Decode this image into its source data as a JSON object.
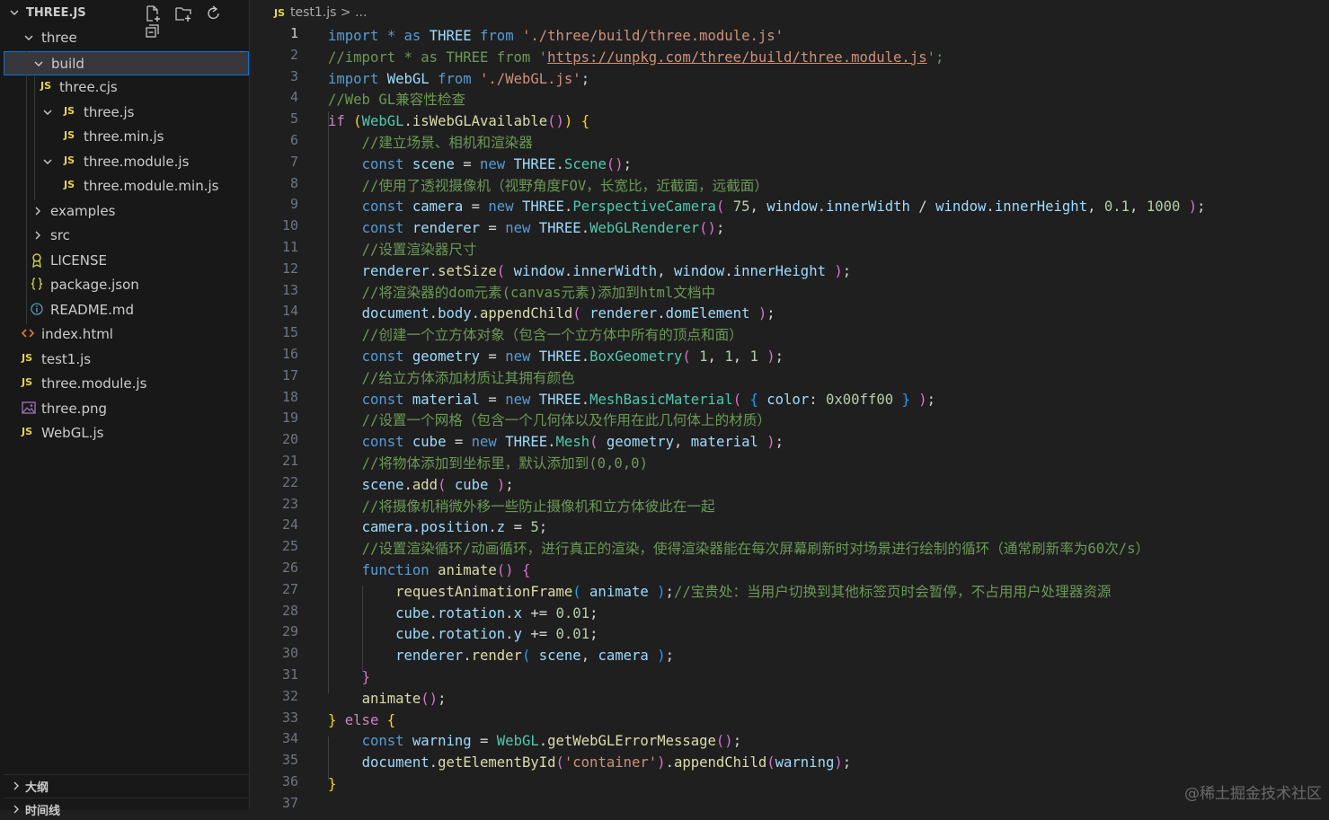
{
  "explorer": {
    "title": "THREE.JS",
    "actions": [
      "new-file-icon",
      "new-folder-icon",
      "refresh-icon",
      "collapse-all-icon"
    ],
    "items": [
      {
        "label": "three",
        "kind": "folder",
        "depth": 1,
        "expanded": true,
        "icon": "chevron-down-icon"
      },
      {
        "label": "build",
        "kind": "folder",
        "depth": 2,
        "expanded": true,
        "selected": true,
        "icon": "chevron-down-icon"
      },
      {
        "label": "three.cjs",
        "kind": "js",
        "depth": 3,
        "icon": "js-file-icon"
      },
      {
        "label": "three.js",
        "kind": "js",
        "depth": 3,
        "expanded": true,
        "icon": "js-file-icon"
      },
      {
        "label": "three.min.js",
        "kind": "js",
        "depth": 4,
        "icon": "js-file-icon"
      },
      {
        "label": "three.module.js",
        "kind": "js",
        "depth": 3,
        "expanded": true,
        "icon": "js-file-icon"
      },
      {
        "label": "three.module.min.js",
        "kind": "js",
        "depth": 4,
        "icon": "js-file-icon"
      },
      {
        "label": "examples",
        "kind": "folder",
        "depth": 2,
        "expanded": false,
        "icon": "chevron-right-icon"
      },
      {
        "label": "src",
        "kind": "folder",
        "depth": 2,
        "expanded": false,
        "icon": "chevron-right-icon"
      },
      {
        "label": "LICENSE",
        "kind": "license",
        "depth": 2,
        "icon": "license-icon"
      },
      {
        "label": "package.json",
        "kind": "json",
        "depth": 2,
        "icon": "json-file-icon"
      },
      {
        "label": "README.md",
        "kind": "info",
        "depth": 2,
        "icon": "info-icon"
      },
      {
        "label": "index.html",
        "kind": "html",
        "depth": 1,
        "icon": "html-file-icon"
      },
      {
        "label": "test1.js",
        "kind": "js",
        "depth": 1,
        "icon": "js-file-icon"
      },
      {
        "label": "three.module.js",
        "kind": "js",
        "depth": 1,
        "icon": "js-file-icon"
      },
      {
        "label": "three.png",
        "kind": "image",
        "depth": 1,
        "icon": "image-file-icon"
      },
      {
        "label": "WebGL.js",
        "kind": "js",
        "depth": 1,
        "icon": "js-file-icon"
      }
    ],
    "outline_label": "大纲",
    "timeline_label": "时间线"
  },
  "editor": {
    "file_icon_text": "JS",
    "breadcrumb_file": "test1.js",
    "breadcrumb_sep": ">",
    "breadcrumb_more": "...",
    "active_line": 1,
    "lines": [
      [
        [
          "kw",
          "import"
        ],
        [
          "pun",
          " "
        ],
        [
          "kw",
          "*"
        ],
        [
          "pun",
          " "
        ],
        [
          "kw",
          "as"
        ],
        [
          "pun",
          " "
        ],
        [
          "var",
          "THREE"
        ],
        [
          "pun",
          " "
        ],
        [
          "kw",
          "from"
        ],
        [
          "pun",
          " "
        ],
        [
          "str",
          "'./three/build/three.module.js'"
        ]
      ],
      [
        [
          "cmt",
          "//import * as THREE from '"
        ],
        [
          "link",
          "https://unpkg.com/three/build/three.module.js"
        ],
        [
          "cmt",
          "';"
        ]
      ],
      [
        [
          "kw",
          "import"
        ],
        [
          "pun",
          " "
        ],
        [
          "var",
          "WebGL"
        ],
        [
          "pun",
          " "
        ],
        [
          "kw",
          "from"
        ],
        [
          "pun",
          " "
        ],
        [
          "str",
          "'./WebGL.js'"
        ],
        [
          "pun",
          ";"
        ]
      ],
      [
        [
          "cmt",
          "//Web GL兼容性检查"
        ]
      ],
      [
        [
          "ctl",
          "if"
        ],
        [
          "pun",
          " "
        ],
        [
          "br1",
          "("
        ],
        [
          "cls",
          "WebGL"
        ],
        [
          "pun",
          "."
        ],
        [
          "fn",
          "isWebGLAvailable"
        ],
        [
          "br2",
          "()"
        ],
        [
          "br1",
          ")"
        ],
        [
          "pun",
          " "
        ],
        [
          "br1",
          "{"
        ]
      ],
      [
        [
          "pun",
          "    "
        ],
        [
          "cmt",
          "//建立场景、相机和渲染器"
        ]
      ],
      [
        [
          "pun",
          "    "
        ],
        [
          "kw",
          "const"
        ],
        [
          "pun",
          " "
        ],
        [
          "var",
          "scene"
        ],
        [
          "pun",
          " = "
        ],
        [
          "kw",
          "new"
        ],
        [
          "pun",
          " "
        ],
        [
          "var",
          "THREE"
        ],
        [
          "pun",
          "."
        ],
        [
          "cls",
          "Scene"
        ],
        [
          "br2",
          "()"
        ],
        [
          "pun",
          ";"
        ]
      ],
      [
        [
          "pun",
          "    "
        ],
        [
          "cmt",
          "//使用了透视摄像机（视野角度FOV，长宽比，近截面，远截面）"
        ]
      ],
      [
        [
          "pun",
          "    "
        ],
        [
          "kw",
          "const"
        ],
        [
          "pun",
          " "
        ],
        [
          "var",
          "camera"
        ],
        [
          "pun",
          " = "
        ],
        [
          "kw",
          "new"
        ],
        [
          "pun",
          " "
        ],
        [
          "var",
          "THREE"
        ],
        [
          "pun",
          "."
        ],
        [
          "cls",
          "PerspectiveCamera"
        ],
        [
          "br2",
          "("
        ],
        [
          "pun",
          " "
        ],
        [
          "num",
          "75"
        ],
        [
          "pun",
          ", "
        ],
        [
          "var",
          "window"
        ],
        [
          "pun",
          "."
        ],
        [
          "var",
          "innerWidth"
        ],
        [
          "pun",
          " / "
        ],
        [
          "var",
          "window"
        ],
        [
          "pun",
          "."
        ],
        [
          "var",
          "innerHeight"
        ],
        [
          "pun",
          ", "
        ],
        [
          "num",
          "0.1"
        ],
        [
          "pun",
          ", "
        ],
        [
          "num",
          "1000"
        ],
        [
          "pun",
          " "
        ],
        [
          "br2",
          ")"
        ],
        [
          "pun",
          ";"
        ]
      ],
      [
        [
          "pun",
          "    "
        ],
        [
          "kw",
          "const"
        ],
        [
          "pun",
          " "
        ],
        [
          "var",
          "renderer"
        ],
        [
          "pun",
          " = "
        ],
        [
          "kw",
          "new"
        ],
        [
          "pun",
          " "
        ],
        [
          "var",
          "THREE"
        ],
        [
          "pun",
          "."
        ],
        [
          "cls",
          "WebGLRenderer"
        ],
        [
          "br2",
          "()"
        ],
        [
          "pun",
          ";"
        ]
      ],
      [
        [
          "pun",
          "    "
        ],
        [
          "cmt",
          "//设置渲染器尺寸"
        ]
      ],
      [
        [
          "pun",
          "    "
        ],
        [
          "var",
          "renderer"
        ],
        [
          "pun",
          "."
        ],
        [
          "fn",
          "setSize"
        ],
        [
          "br2",
          "("
        ],
        [
          "pun",
          " "
        ],
        [
          "var",
          "window"
        ],
        [
          "pun",
          "."
        ],
        [
          "var",
          "innerWidth"
        ],
        [
          "pun",
          ", "
        ],
        [
          "var",
          "window"
        ],
        [
          "pun",
          "."
        ],
        [
          "var",
          "innerHeight"
        ],
        [
          "pun",
          " "
        ],
        [
          "br2",
          ")"
        ],
        [
          "pun",
          ";"
        ]
      ],
      [
        [
          "pun",
          "    "
        ],
        [
          "cmt",
          "//将渲染器的dom元素(canvas元素)添加到html文档中"
        ]
      ],
      [
        [
          "pun",
          "    "
        ],
        [
          "var",
          "document"
        ],
        [
          "pun",
          "."
        ],
        [
          "var",
          "body"
        ],
        [
          "pun",
          "."
        ],
        [
          "fn",
          "appendChild"
        ],
        [
          "br2",
          "("
        ],
        [
          "pun",
          " "
        ],
        [
          "var",
          "renderer"
        ],
        [
          "pun",
          "."
        ],
        [
          "var",
          "domElement"
        ],
        [
          "pun",
          " "
        ],
        [
          "br2",
          ")"
        ],
        [
          "pun",
          ";"
        ]
      ],
      [
        [
          "pun",
          "    "
        ],
        [
          "cmt",
          "//创建一个立方体对象（包含一个立方体中所有的顶点和面）"
        ]
      ],
      [
        [
          "pun",
          "    "
        ],
        [
          "kw",
          "const"
        ],
        [
          "pun",
          " "
        ],
        [
          "var",
          "geometry"
        ],
        [
          "pun",
          " = "
        ],
        [
          "kw",
          "new"
        ],
        [
          "pun",
          " "
        ],
        [
          "var",
          "THREE"
        ],
        [
          "pun",
          "."
        ],
        [
          "cls",
          "BoxGeometry"
        ],
        [
          "br2",
          "("
        ],
        [
          "pun",
          " "
        ],
        [
          "num",
          "1"
        ],
        [
          "pun",
          ", "
        ],
        [
          "num",
          "1"
        ],
        [
          "pun",
          ", "
        ],
        [
          "num",
          "1"
        ],
        [
          "pun",
          " "
        ],
        [
          "br2",
          ")"
        ],
        [
          "pun",
          ";"
        ]
      ],
      [
        [
          "pun",
          "    "
        ],
        [
          "cmt",
          "//给立方体添加材质让其拥有颜色"
        ]
      ],
      [
        [
          "pun",
          "    "
        ],
        [
          "kw",
          "const"
        ],
        [
          "pun",
          " "
        ],
        [
          "var",
          "material"
        ],
        [
          "pun",
          " = "
        ],
        [
          "kw",
          "new"
        ],
        [
          "pun",
          " "
        ],
        [
          "var",
          "THREE"
        ],
        [
          "pun",
          "."
        ],
        [
          "cls",
          "MeshBasicMaterial"
        ],
        [
          "br2",
          "("
        ],
        [
          "pun",
          " "
        ],
        [
          "br3",
          "{"
        ],
        [
          "pun",
          " "
        ],
        [
          "var",
          "color"
        ],
        [
          "pun",
          ": "
        ],
        [
          "num",
          "0x00ff00"
        ],
        [
          "pun",
          " "
        ],
        [
          "br3",
          "}"
        ],
        [
          "pun",
          " "
        ],
        [
          "br2",
          ")"
        ],
        [
          "pun",
          ";"
        ]
      ],
      [
        [
          "pun",
          "    "
        ],
        [
          "cmt",
          "//设置一个网格（包含一个几何体以及作用在此几何体上的材质）"
        ]
      ],
      [
        [
          "pun",
          "    "
        ],
        [
          "kw",
          "const"
        ],
        [
          "pun",
          " "
        ],
        [
          "var",
          "cube"
        ],
        [
          "pun",
          " = "
        ],
        [
          "kw",
          "new"
        ],
        [
          "pun",
          " "
        ],
        [
          "var",
          "THREE"
        ],
        [
          "pun",
          "."
        ],
        [
          "cls",
          "Mesh"
        ],
        [
          "br2",
          "("
        ],
        [
          "pun",
          " "
        ],
        [
          "var",
          "geometry"
        ],
        [
          "pun",
          ", "
        ],
        [
          "var",
          "material"
        ],
        [
          "pun",
          " "
        ],
        [
          "br2",
          ")"
        ],
        [
          "pun",
          ";"
        ]
      ],
      [
        [
          "pun",
          "    "
        ],
        [
          "cmt",
          "//将物体添加到坐标里，默认添加到(0,0,0)"
        ]
      ],
      [
        [
          "pun",
          "    "
        ],
        [
          "var",
          "scene"
        ],
        [
          "pun",
          "."
        ],
        [
          "fn",
          "add"
        ],
        [
          "br2",
          "("
        ],
        [
          "pun",
          " "
        ],
        [
          "var",
          "cube"
        ],
        [
          "pun",
          " "
        ],
        [
          "br2",
          ")"
        ],
        [
          "pun",
          ";"
        ]
      ],
      [
        [
          "pun",
          "    "
        ],
        [
          "cmt",
          "//将摄像机稍微外移一些防止摄像机和立方体彼此在一起"
        ]
      ],
      [
        [
          "pun",
          "    "
        ],
        [
          "var",
          "camera"
        ],
        [
          "pun",
          "."
        ],
        [
          "var",
          "position"
        ],
        [
          "pun",
          "."
        ],
        [
          "var",
          "z"
        ],
        [
          "pun",
          " = "
        ],
        [
          "num",
          "5"
        ],
        [
          "pun",
          ";"
        ]
      ],
      [
        [
          "pun",
          "    "
        ],
        [
          "cmt",
          "//设置渲染循环/动画循环，进行真正的渲染，使得渲染器能在每次屏幕刷新时对场景进行绘制的循环（通常刷新率为60次/s）"
        ]
      ],
      [
        [
          "pun",
          "    "
        ],
        [
          "kw",
          "function"
        ],
        [
          "pun",
          " "
        ],
        [
          "fn",
          "animate"
        ],
        [
          "br2",
          "()"
        ],
        [
          "pun",
          " "
        ],
        [
          "br2",
          "{"
        ]
      ],
      [
        [
          "pun",
          "        "
        ],
        [
          "fn",
          "requestAnimationFrame"
        ],
        [
          "br3",
          "("
        ],
        [
          "pun",
          " "
        ],
        [
          "var",
          "animate"
        ],
        [
          "pun",
          " "
        ],
        [
          "br3",
          ")"
        ],
        [
          "pun",
          ";"
        ],
        [
          "cmt",
          "//宝贵处：当用户切换到其他标签页时会暂停，不占用用户处理器资源"
        ]
      ],
      [
        [
          "pun",
          "        "
        ],
        [
          "var",
          "cube"
        ],
        [
          "pun",
          "."
        ],
        [
          "var",
          "rotation"
        ],
        [
          "pun",
          "."
        ],
        [
          "var",
          "x"
        ],
        [
          "pun",
          " += "
        ],
        [
          "num",
          "0.01"
        ],
        [
          "pun",
          ";"
        ]
      ],
      [
        [
          "pun",
          "        "
        ],
        [
          "var",
          "cube"
        ],
        [
          "pun",
          "."
        ],
        [
          "var",
          "rotation"
        ],
        [
          "pun",
          "."
        ],
        [
          "var",
          "y"
        ],
        [
          "pun",
          " += "
        ],
        [
          "num",
          "0.01"
        ],
        [
          "pun",
          ";"
        ]
      ],
      [
        [
          "pun",
          "        "
        ],
        [
          "var",
          "renderer"
        ],
        [
          "pun",
          "."
        ],
        [
          "fn",
          "render"
        ],
        [
          "br3",
          "("
        ],
        [
          "pun",
          " "
        ],
        [
          "var",
          "scene"
        ],
        [
          "pun",
          ", "
        ],
        [
          "var",
          "camera"
        ],
        [
          "pun",
          " "
        ],
        [
          "br3",
          ")"
        ],
        [
          "pun",
          ";"
        ]
      ],
      [
        [
          "pun",
          "    "
        ],
        [
          "br2",
          "}"
        ]
      ],
      [
        [
          "pun",
          "    "
        ],
        [
          "fn",
          "animate"
        ],
        [
          "br2",
          "()"
        ],
        [
          "pun",
          ";"
        ]
      ],
      [
        [
          "br1",
          "}"
        ],
        [
          "pun",
          " "
        ],
        [
          "ctl",
          "else"
        ],
        [
          "pun",
          " "
        ],
        [
          "br1",
          "{"
        ]
      ],
      [
        [
          "pun",
          "    "
        ],
        [
          "kw",
          "const"
        ],
        [
          "pun",
          " "
        ],
        [
          "var",
          "warning"
        ],
        [
          "pun",
          " = "
        ],
        [
          "cls",
          "WebGL"
        ],
        [
          "pun",
          "."
        ],
        [
          "fn",
          "getWebGLErrorMessage"
        ],
        [
          "br2",
          "()"
        ],
        [
          "pun",
          ";"
        ]
      ],
      [
        [
          "pun",
          "    "
        ],
        [
          "var",
          "document"
        ],
        [
          "pun",
          "."
        ],
        [
          "fn",
          "getElementById"
        ],
        [
          "br2",
          "("
        ],
        [
          "str",
          "'container'"
        ],
        [
          "br2",
          ")"
        ],
        [
          "pun",
          "."
        ],
        [
          "fn",
          "appendChild"
        ],
        [
          "br2",
          "("
        ],
        [
          "var",
          "warning"
        ],
        [
          "br2",
          ")"
        ],
        [
          "pun",
          ";"
        ]
      ],
      [
        [
          "br1",
          "}"
        ]
      ],
      []
    ]
  },
  "watermark": "@稀土掘金技术社区"
}
